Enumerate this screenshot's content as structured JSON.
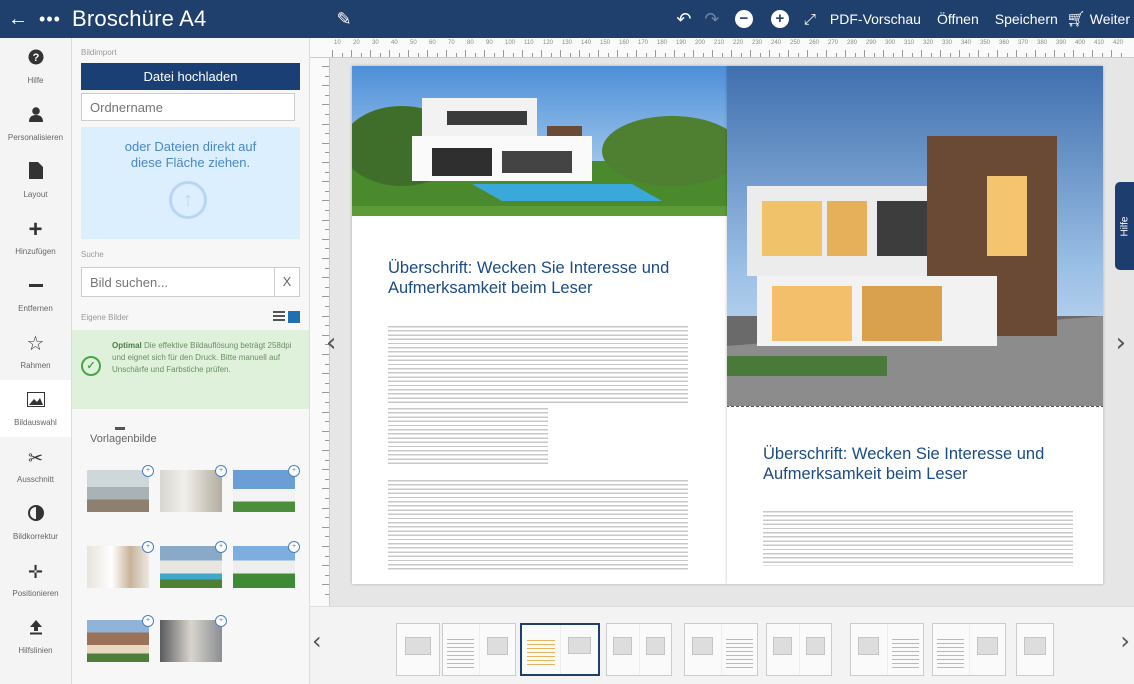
{
  "header": {
    "title": "Broschüre A4",
    "pdf_preview": "PDF-Vorschau",
    "open": "Öffnen",
    "save": "Speichern",
    "next": "Weiter"
  },
  "sidebar": {
    "items": [
      {
        "label": "Hilfe",
        "icon": "help-icon"
      },
      {
        "label": "Personalisieren",
        "icon": "user-icon"
      },
      {
        "label": "Layout",
        "icon": "layout-icon"
      },
      {
        "label": "Hinzufügen",
        "icon": "plus-icon"
      },
      {
        "label": "Entfernen",
        "icon": "minus-icon"
      },
      {
        "label": "Rahmen",
        "icon": "star-icon"
      },
      {
        "label": "Bildauswahl",
        "icon": "image-icon"
      },
      {
        "label": "Ausschnitt",
        "icon": "scissors-icon"
      },
      {
        "label": "Bildkorrektur",
        "icon": "contrast-icon"
      },
      {
        "label": "Positionieren",
        "icon": "move-icon"
      },
      {
        "label": "Hilfslinien",
        "icon": "upload-icon"
      }
    ],
    "active_index": 6
  },
  "panel": {
    "import_label": "Bildimport",
    "upload_button": "Datei hochladen",
    "folder_placeholder": "Ordnername",
    "dropzone_text": "oder Dateien direkt auf diese Fläche ziehen.",
    "search_label": "Suche",
    "search_placeholder": "Bild suchen...",
    "search_clear": "X",
    "own_images_label": "Eigene Bilder",
    "notice_bold": "Optimal",
    "notice_text": " Die effektive Bildauflösung beträgt 258dpi und eignet sich für den Druck. Bitte manuell auf Unschärfe und Farbstiche prüfen.",
    "templates_label": "Vorlagenbilde"
  },
  "document": {
    "left_heading": "Überschrift: Wecken Sie Interesse und Aufmerksamkeit beim Leser",
    "right_heading": "Überschrift: Wecken Sie Interesse und Aufmerksamkeit beim Leser"
  },
  "help_tab": "Hilfe",
  "ruler_numbers": [
    "10",
    "20",
    "30",
    "40",
    "50",
    "60",
    "70",
    "80",
    "90",
    "100",
    "110",
    "120",
    "130",
    "140",
    "150",
    "160",
    "170",
    "180",
    "190",
    "200",
    "210",
    "220",
    "230",
    "240",
    "250",
    "260",
    "270",
    "280",
    "290",
    "300",
    "310",
    "320",
    "330",
    "340",
    "350",
    "360",
    "370",
    "380",
    "390",
    "400",
    "410",
    "420"
  ],
  "colors": {
    "brand": "#1f3f6d",
    "heading": "#1b4b85",
    "dropzone": "#dcefff",
    "notice": "#dff1db"
  }
}
